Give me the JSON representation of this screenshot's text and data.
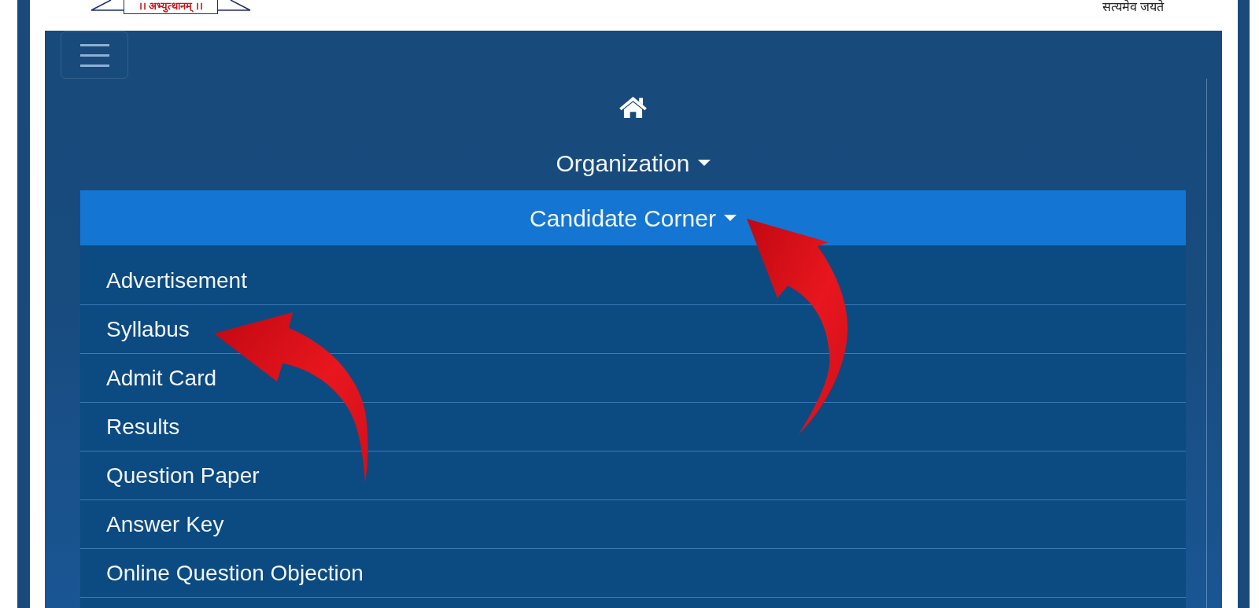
{
  "header": {
    "logo_motto": "।। अभ्युत्थानम् ।।",
    "emblem_motto": "सत्यमेव जयते"
  },
  "navbar": {
    "menu": [
      {
        "kind": "home"
      },
      {
        "kind": "dropdown",
        "label": "Organization",
        "expanded": false
      },
      {
        "kind": "dropdown",
        "label": "Candidate Corner",
        "expanded": true,
        "annotation_arrow": {
          "kind": "up"
        },
        "items": [
          {
            "label": "Advertisement"
          },
          {
            "label": "Syllabus",
            "annotation_arrow": {
              "kind": "left"
            }
          },
          {
            "label": "Admit Card"
          },
          {
            "label": "Results"
          },
          {
            "label": "Question Paper"
          },
          {
            "label": "Answer Key"
          },
          {
            "label": "Online Question Objection"
          }
        ]
      }
    ]
  }
}
